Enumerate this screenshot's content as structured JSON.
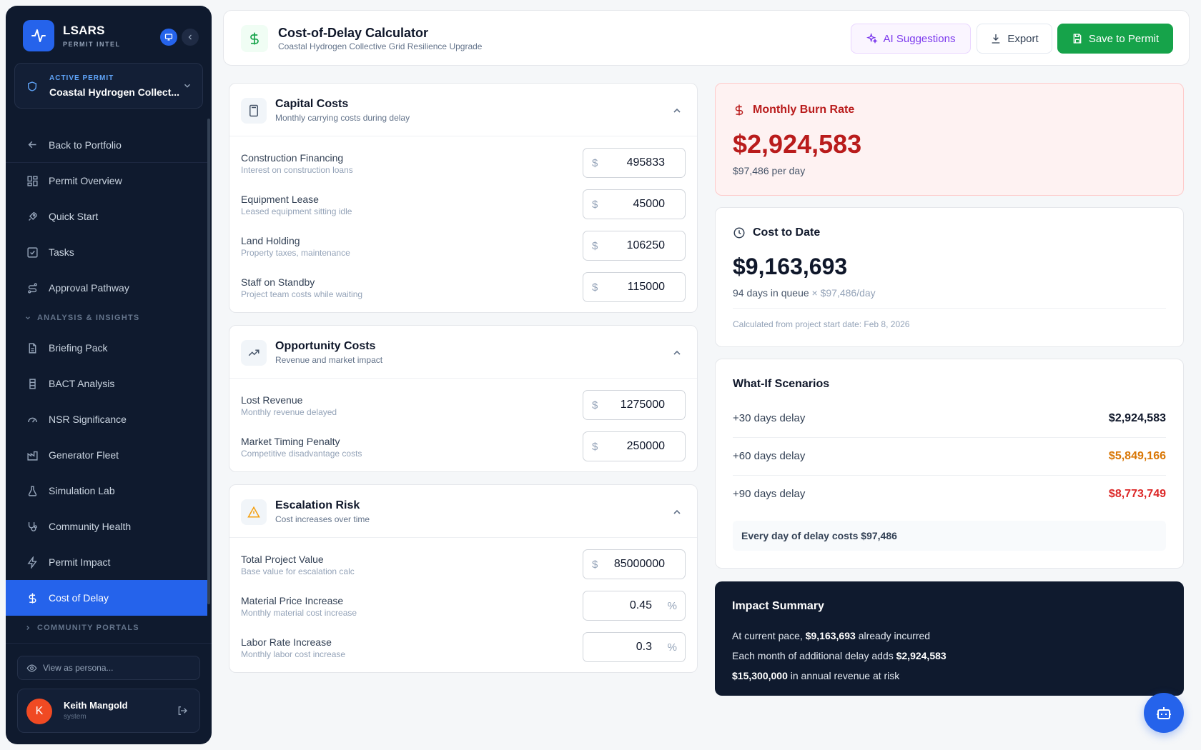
{
  "brand": {
    "name": "LSARS",
    "subtitle": "PERMIT INTEL"
  },
  "permit": {
    "label": "ACTIVE PERMIT",
    "name": "Coastal Hydrogen Collect..."
  },
  "nav": {
    "back": "Back to Portfolio",
    "items": [
      "Permit Overview",
      "Quick Start",
      "Tasks",
      "Approval Pathway"
    ],
    "section_analysis": "ANALYSIS & INSIGHTS",
    "analysis_items": [
      "Briefing Pack",
      "BACT Analysis",
      "NSR Significance",
      "Generator Fleet",
      "Simulation Lab",
      "Community Health",
      "Permit Impact",
      "Cost of Delay"
    ],
    "section_portals": "COMMUNITY PORTALS"
  },
  "persona": "View as persona...",
  "user": {
    "initial": "K",
    "name": "Keith Mangold",
    "role": "system"
  },
  "header": {
    "title": "Cost-of-Delay Calculator",
    "subtitle": "Coastal Hydrogen Collective Grid Resilience Upgrade",
    "ai_label": "AI Suggestions",
    "export_label": "Export",
    "save_label": "Save to Permit"
  },
  "capital": {
    "title": "Capital Costs",
    "subtitle": "Monthly carrying costs during delay",
    "rows": [
      {
        "label": "Construction Financing",
        "desc": "Interest on construction loans",
        "value": "495833"
      },
      {
        "label": "Equipment Lease",
        "desc": "Leased equipment sitting idle",
        "value": "45000"
      },
      {
        "label": "Land Holding",
        "desc": "Property taxes, maintenance",
        "value": "106250"
      },
      {
        "label": "Staff on Standby",
        "desc": "Project team costs while waiting",
        "value": "115000"
      }
    ]
  },
  "opportunity": {
    "title": "Opportunity Costs",
    "subtitle": "Revenue and market impact",
    "rows": [
      {
        "label": "Lost Revenue",
        "desc": "Monthly revenue delayed",
        "value": "1275000"
      },
      {
        "label": "Market Timing Penalty",
        "desc": "Competitive disadvantage costs",
        "value": "250000"
      }
    ]
  },
  "escalation": {
    "title": "Escalation Risk",
    "subtitle": "Cost increases over time",
    "rows": [
      {
        "label": "Total Project Value",
        "desc": "Base value for escalation calc",
        "value": "85000000"
      },
      {
        "label": "Material Price Increase",
        "desc": "Monthly material cost increase",
        "value": "0.45"
      },
      {
        "label": "Labor Rate Increase",
        "desc": "Monthly labor cost increase",
        "value": "0.3"
      }
    ]
  },
  "currency_symbol": "$",
  "percent_symbol": "%",
  "burn": {
    "label": "Monthly Burn Rate",
    "value": "$2,924,583",
    "per_day": "$97,486 per day"
  },
  "cost_to_date": {
    "label": "Cost to Date",
    "value": "$9,163,693",
    "days_text": "94 days in queue",
    "rate_text": "× $97,486/day",
    "note": "Calculated from project start date: Feb 8, 2026"
  },
  "whatif": {
    "title": "What-If Scenarios",
    "scenarios": [
      {
        "label": "+30 days delay",
        "value": "$2,924,583",
        "color": "#0f172a"
      },
      {
        "label": "+60 days delay",
        "value": "$5,849,166",
        "color": "#d97706"
      },
      {
        "label": "+90 days delay",
        "value": "$8,773,749",
        "color": "#dc2626"
      }
    ],
    "note": "Every day of delay costs $97,486"
  },
  "impact": {
    "title": "Impact Summary",
    "line1_pre": "At current pace,",
    "line1_bold": "$9,163,693",
    "line1_post": "already incurred",
    "line2_pre": "Each month of additional delay adds",
    "line2_bold": "$2,924,583",
    "line3_bold": "$15,300,000",
    "line3_post": "in annual revenue at risk"
  },
  "colors": {
    "accent": "#2563eb",
    "save": "#16a34a",
    "danger": "#b91c1c",
    "warning": "#d97706",
    "navy": "#0f1a2e"
  }
}
